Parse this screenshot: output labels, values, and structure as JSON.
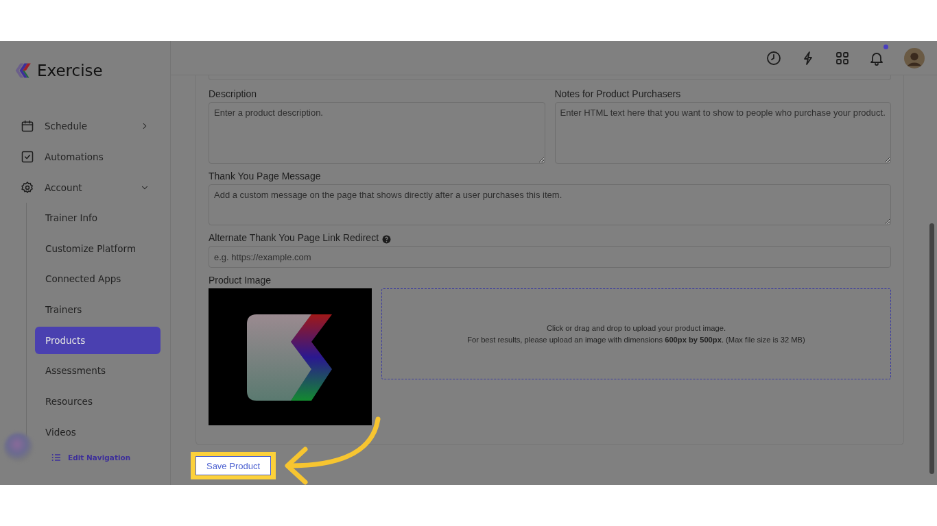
{
  "app": {
    "name": "Exercise"
  },
  "nav": [
    {
      "label": "Schedule",
      "kind": "calendar",
      "expanded": false
    },
    {
      "label": "Automations",
      "kind": "checkbox"
    },
    {
      "label": "Account",
      "kind": "gear",
      "expanded": true,
      "children": [
        {
          "label": "Trainer Info",
          "selected": false
        },
        {
          "label": "Customize Platform",
          "selected": false
        },
        {
          "label": "Connected Apps",
          "selected": false
        },
        {
          "label": "Trainers",
          "selected": false
        },
        {
          "label": "Products",
          "selected": true
        },
        {
          "label": "Assessments",
          "selected": false
        },
        {
          "label": "Resources",
          "selected": false
        },
        {
          "label": "Videos",
          "selected": false
        }
      ]
    }
  ],
  "edit_navigation": "Edit Navigation",
  "topbar": {
    "icons": [
      {
        "kind": "clock"
      },
      {
        "kind": "bolt"
      },
      {
        "kind": "grid"
      },
      {
        "kind": "bell",
        "notification": true
      }
    ]
  },
  "form": {
    "columns": [
      {
        "label": "Description",
        "placeholder": "Enter a product description."
      },
      {
        "label": "Notes for Product Purchasers",
        "placeholder": "Enter HTML text here that you want to show to people who purchase your product."
      }
    ],
    "thank_you": {
      "label": "Thank You Page Message",
      "placeholder": "Add a custom message on the page that shows directly after a user purchases this item."
    },
    "redirect": {
      "label": "Alternate Thank You Page Link Redirect",
      "help": true,
      "placeholder": "e.g. https://example.com"
    },
    "image": {
      "label": "Product Image",
      "upload_lines": [
        "Click or drag and drop to upload your product image.",
        "For best results, please upload an image with dimensions **600px by 500px**. (Max file size is 32 MB)"
      ]
    }
  },
  "save_button": {
    "label": "Save Product",
    "highlighted": true
  }
}
